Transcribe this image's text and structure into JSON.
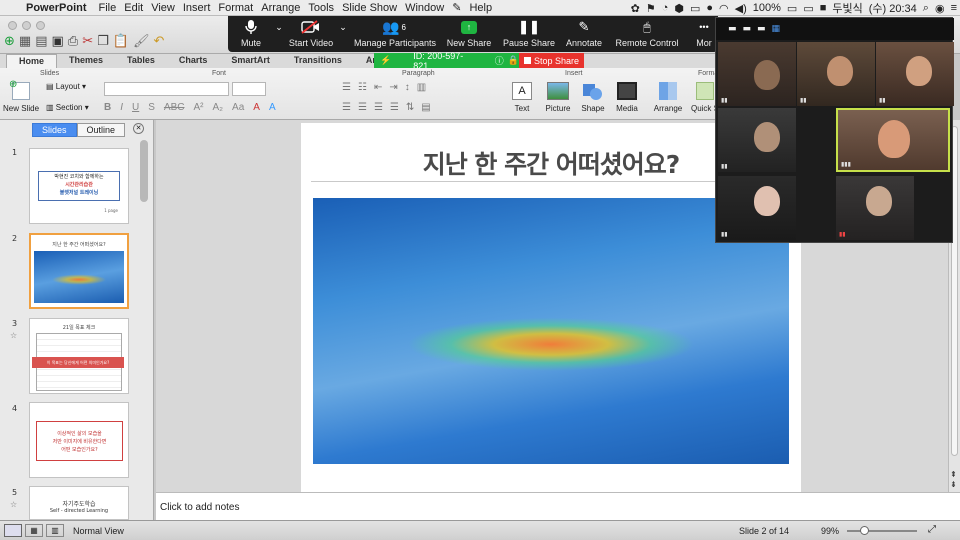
{
  "menubar": {
    "app_name": "PowerPoint",
    "items": [
      "File",
      "Edit",
      "View",
      "Insert",
      "Format",
      "Arrange",
      "Tools",
      "Slide Show",
      "Window",
      "Help"
    ],
    "battery": "100%",
    "user": "두빛식",
    "clock": "(수) 20:34"
  },
  "zoom": {
    "mute": "Mute",
    "start_video": "Start Video",
    "manage_participants": "Manage Participants",
    "participants_count": "6",
    "new_share": "New Share",
    "pause_share": "Pause Share",
    "annotate": "Annotate",
    "remote_control": "Remote Control",
    "more": "Mor",
    "meeting_id": "ID: 200-597-821",
    "stop_share": "Stop Share"
  },
  "ribbon": {
    "tabs": [
      "Home",
      "Themes",
      "Tables",
      "Charts",
      "SmartArt",
      "Transitions",
      "Animati"
    ],
    "active_tab": "Home",
    "groups": {
      "slides": "Slides",
      "font": "Font",
      "paragraph": "Paragraph",
      "insert": "Insert",
      "format": "Forma"
    },
    "new_slide": "New Slide",
    "layout": "Layout",
    "section": "Section",
    "text": "Text",
    "picture": "Picture",
    "shape": "Shape",
    "media": "Media",
    "arrange": "Arrange",
    "quick_styles": "Quick S"
  },
  "left_pane": {
    "tab_slides": "Slides",
    "tab_outline": "Outline",
    "thumbnails": [
      {
        "num": "1",
        "line1": "박현진 코치와 함께하는",
        "line2": "시간관리습관",
        "line3": "불렛저널 트레이닝",
        "footer": "1 page"
      },
      {
        "num": "2",
        "title": "지난 한 주간 어떠셨어요?"
      },
      {
        "num": "3",
        "title": "21일 목표 체크",
        "banner": "이 목표는 당신에게 어떤 의미인가요?"
      },
      {
        "num": "4",
        "line1": "이상적인 삶의 모습을",
        "line2": "저만 이미지에 비유한다면",
        "line3": "어떤 모습인가요?"
      },
      {
        "num": "5",
        "line1": "자기주도학습",
        "line2": "Self - directed Learning"
      }
    ]
  },
  "slide": {
    "title": "지난 한 주간 어떠셨어요?"
  },
  "notes_placeholder": "Click to add notes",
  "status": {
    "view": "Normal View",
    "slide_count": "Slide 2 of 14",
    "zoom": "99%"
  }
}
